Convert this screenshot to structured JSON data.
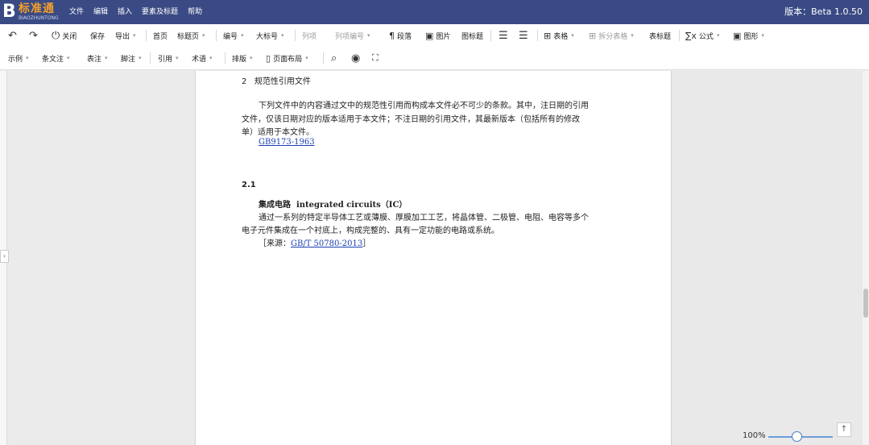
{
  "app": {
    "logo": {
      "initial": "B",
      "name": "标准通",
      "subtitle": "BIAOZHUNTONG"
    },
    "version": "版本：Beta 1.0.50"
  },
  "menu": [
    "文件",
    "编辑",
    "插入",
    "要素及标题",
    "帮助"
  ],
  "toolbar1": {
    "undo_icon": "↶",
    "redo_icon": "↷",
    "close_label": "关闭",
    "save_label": "保存",
    "export_label": "导出",
    "cover_label": "首页",
    "title_label": "标题页",
    "number_label": "编号",
    "level_label": "大标号",
    "list_label": "列项",
    "list_num_label": "列项编号",
    "para_label": "段落",
    "image_label": "图片",
    "figure_title_label": "图标题",
    "table_label": "表格",
    "split_table_label": "拆分表格",
    "table_title_label": "表标题",
    "formula_label": "公式",
    "shape_label": "图形"
  },
  "toolbar2": {
    "example_label": "示例",
    "clause_label": "条文注",
    "note_label": "表注",
    "footnote_label": "脚注",
    "quote_label": "引用",
    "term_label": "术语",
    "layout_label": "排版",
    "page_setup_label": "页面布局"
  },
  "document": {
    "section_number": "2",
    "section_title": "规范性引用文件",
    "paragraph_line1": "下列文件中的内容通过文中的规范性引用而构成本文件必不可少的条款。其中，注日期的引用",
    "paragraph_line2": "文件，仅该日期对应的版本适用于本文件；不注日期的引用文件，其最新版本（包括所有的修改",
    "paragraph_line3": "单）适用于本文件。",
    "reference": "GB9173-1963",
    "clause_number": "2.1",
    "term_zh": "集成电路",
    "term_en": "integrated circuits（IC）",
    "definition_line1": "通过一系列的特定半导体工艺或薄膜、厚膜加工工艺，将晶体管、二极管、电阻、电容等多个",
    "definition_line2": "电子元件集成在一个衬底上，构成完整的、具有一定功能的电路或系统。",
    "source_prefix": "［来源：",
    "source_ref": "GB/T 50780-2013",
    "source_suffix": "］"
  },
  "zoom": {
    "label": "100%",
    "value_percent": 100
  }
}
